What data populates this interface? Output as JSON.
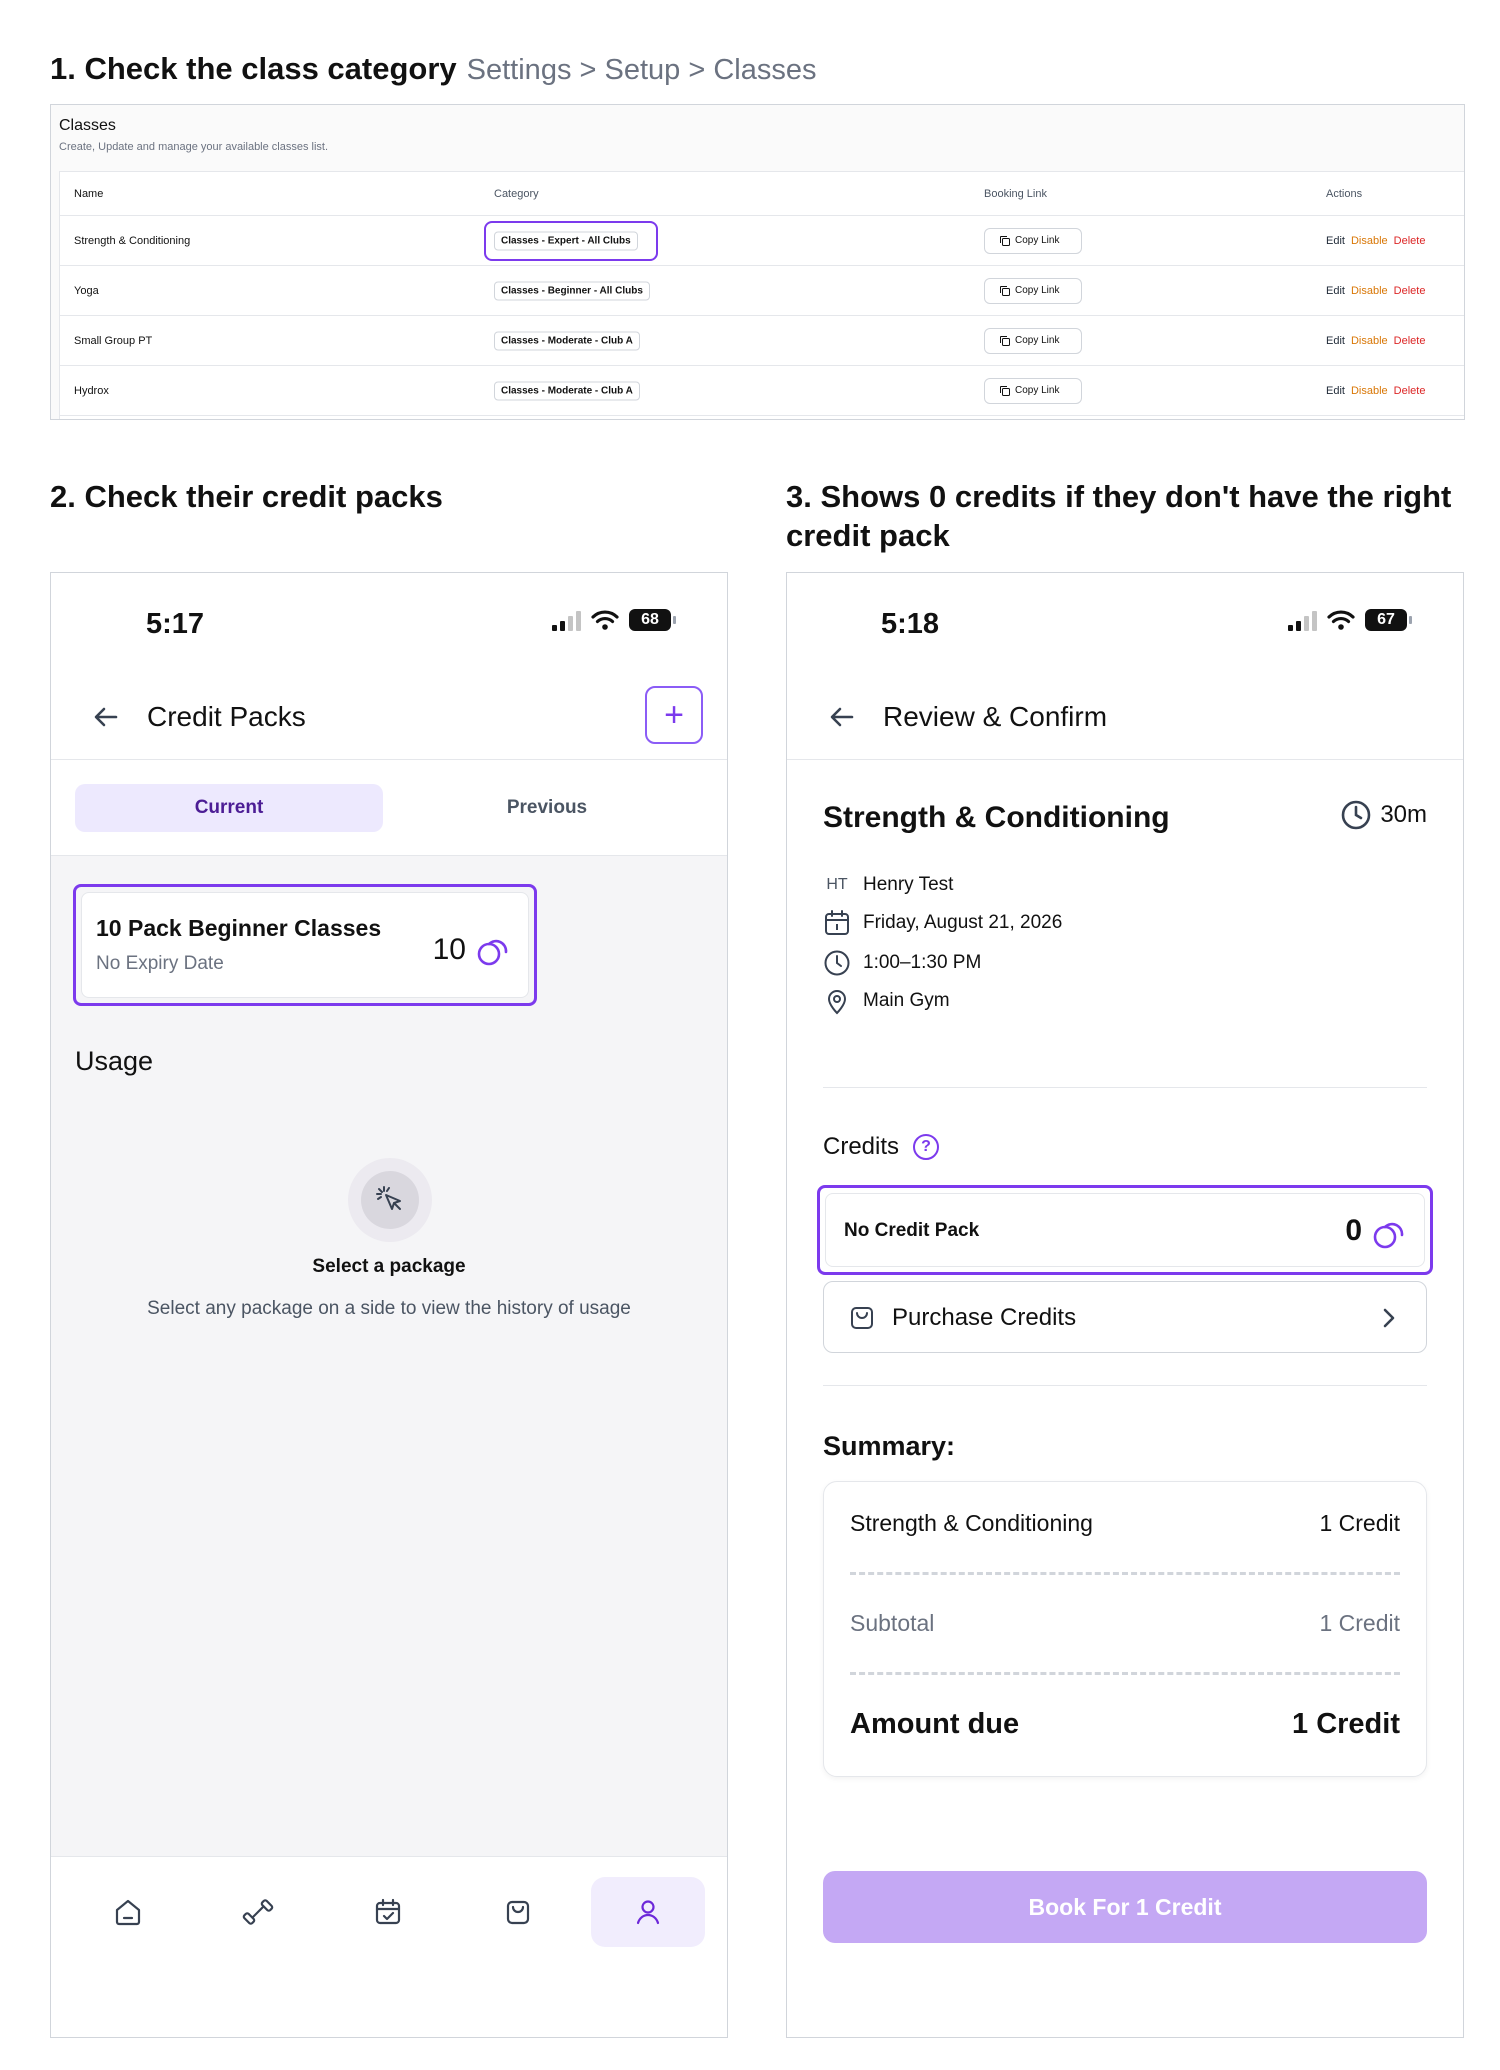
{
  "step1": {
    "title": "1. Check the class category",
    "breadcrumb": "Settings > Setup > Classes"
  },
  "step2": {
    "title": "2. Check their credit packs"
  },
  "step3": {
    "title_line1": "3. Shows 0 credits if they don't have the right",
    "title_line2": "credit pack"
  },
  "classes": {
    "title": "Classes",
    "subtitle": "Create, Update and manage your available classes list.",
    "columns": [
      "Name",
      "Category",
      "Booking Link",
      "Actions"
    ],
    "rows": [
      {
        "name": "Strength & Conditioning",
        "category": "Classes - Expert - All Clubs",
        "link": "Copy Link"
      },
      {
        "name": "Yoga",
        "category": "Classes - Beginner - All Clubs",
        "link": "Copy Link"
      },
      {
        "name": "Small Group PT",
        "category": "Classes - Moderate - Club A",
        "link": "Copy Link"
      },
      {
        "name": "Hydrox",
        "category": "Classes - Moderate - Club A",
        "link": "Copy Link"
      }
    ],
    "actions": {
      "edit": "Edit",
      "disable": "Disable",
      "delete": "Delete"
    }
  },
  "left_phone": {
    "time": "5:17",
    "battery": "68",
    "header": "Credit Packs",
    "tabs": {
      "current": "Current",
      "previous": "Previous"
    },
    "pack": {
      "name": "10 Pack Beginner Classes",
      "expiry": "No Expiry Date",
      "count": "10"
    },
    "usage_title": "Usage",
    "empty": {
      "title": "Select a package",
      "desc": "Select any package on a side to view the history of usage"
    },
    "nav_icons": [
      "home-icon",
      "dumbbell-icon",
      "calendar-check-icon",
      "shopping-bag-icon",
      "user-icon"
    ]
  },
  "right_phone": {
    "time": "5:18",
    "battery": "67",
    "header": "Review & Confirm",
    "class_title": "Strength & Conditioning",
    "duration": "30m",
    "attendee_initials": "HT",
    "attendee": "Henry Test",
    "date": "Friday, August 21, 2026",
    "time_range": "1:00–1:30 PM",
    "location": "Main Gym",
    "credits_label": "Credits",
    "help_symbol": "?",
    "no_credit": {
      "label": "No Credit Pack",
      "count": "0"
    },
    "purchase_label": "Purchase Credits",
    "summary_label": "Summary:",
    "summary": {
      "item_name": "Strength & Conditioning",
      "item_value": "1 Credit",
      "subtotal_label": "Subtotal",
      "subtotal_value": "1 Credit",
      "due_label": "Amount due",
      "due_value": "1 Credit"
    },
    "book_label": "Book For 1 Credit"
  },
  "colors": {
    "accent": "#7c3aed",
    "accent_soft": "#ede9fe",
    "book_button": "#c4a8f4",
    "disable": "#d97706",
    "delete": "#dc2626"
  }
}
